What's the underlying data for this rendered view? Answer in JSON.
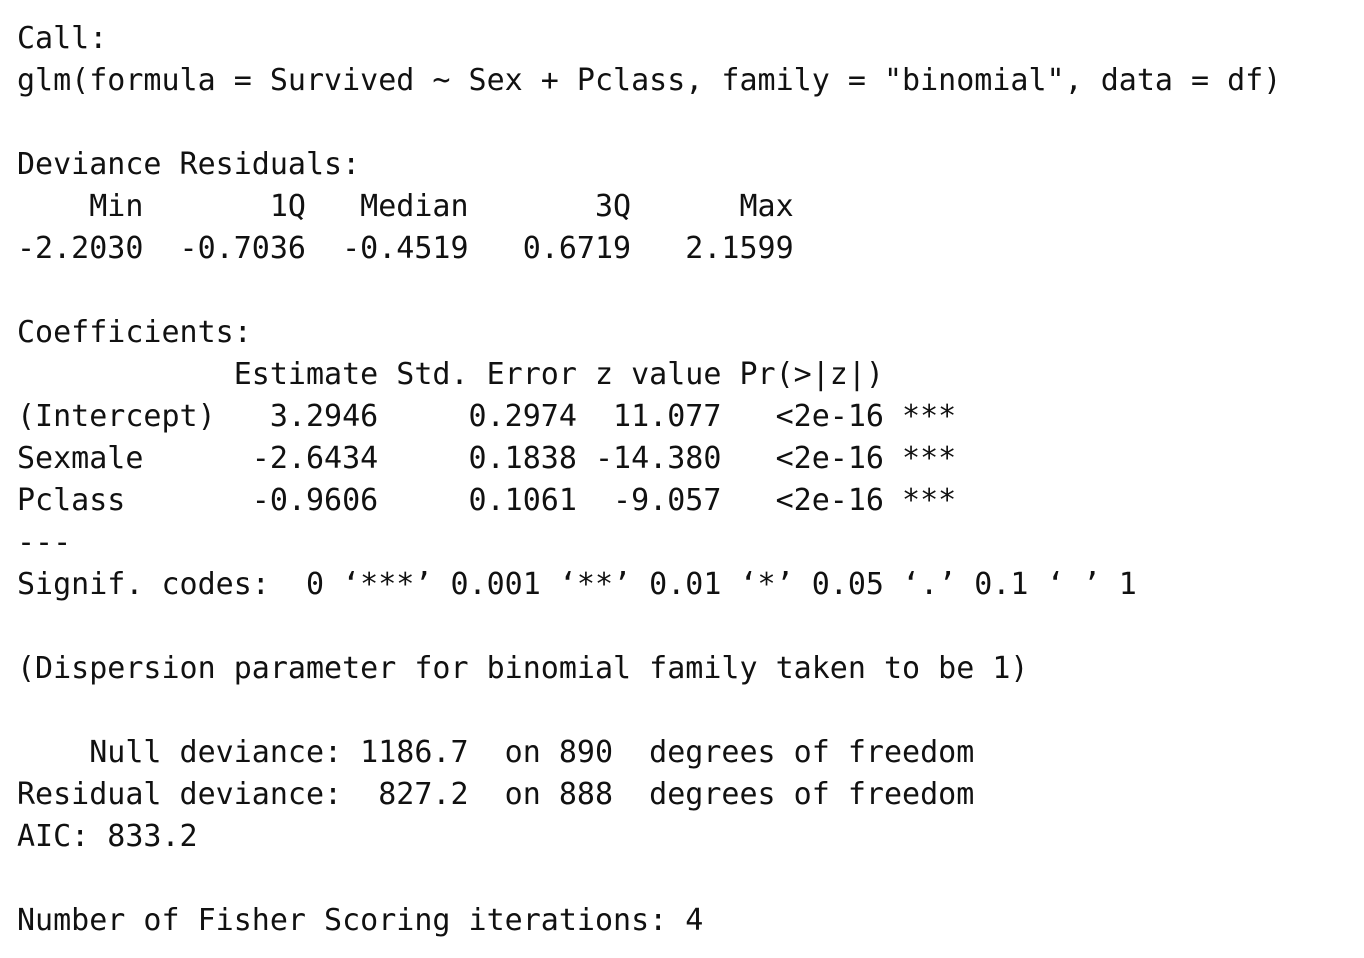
{
  "output_lines": [
    "Call:",
    "glm(formula = Survived ~ Sex + Pclass, family = \"binomial\", data = df)",
    "",
    "Deviance Residuals:",
    "    Min       1Q   Median       3Q      Max",
    "-2.2030  -0.7036  -0.4519   0.6719   2.1599",
    "",
    "Coefficients:",
    "            Estimate Std. Error z value Pr(>|z|)",
    "(Intercept)   3.2946     0.2974  11.077   <2e-16 ***",
    "Sexmale      -2.6434     0.1838 -14.380   <2e-16 ***",
    "Pclass       -0.9606     0.1061  -9.057   <2e-16 ***",
    "---",
    "Signif. codes:  0 ‘***’ 0.001 ‘**’ 0.01 ‘*’ 0.05 ‘.’ 0.1 ‘ ’ 1",
    "",
    "(Dispersion parameter for binomial family taken to be 1)",
    "",
    "    Null deviance: 1186.7  on 890  degrees of freedom",
    "Residual deviance:  827.2  on 888  degrees of freedom",
    "AIC: 833.2",
    "",
    "Number of Fisher Scoring iterations: 4"
  ]
}
